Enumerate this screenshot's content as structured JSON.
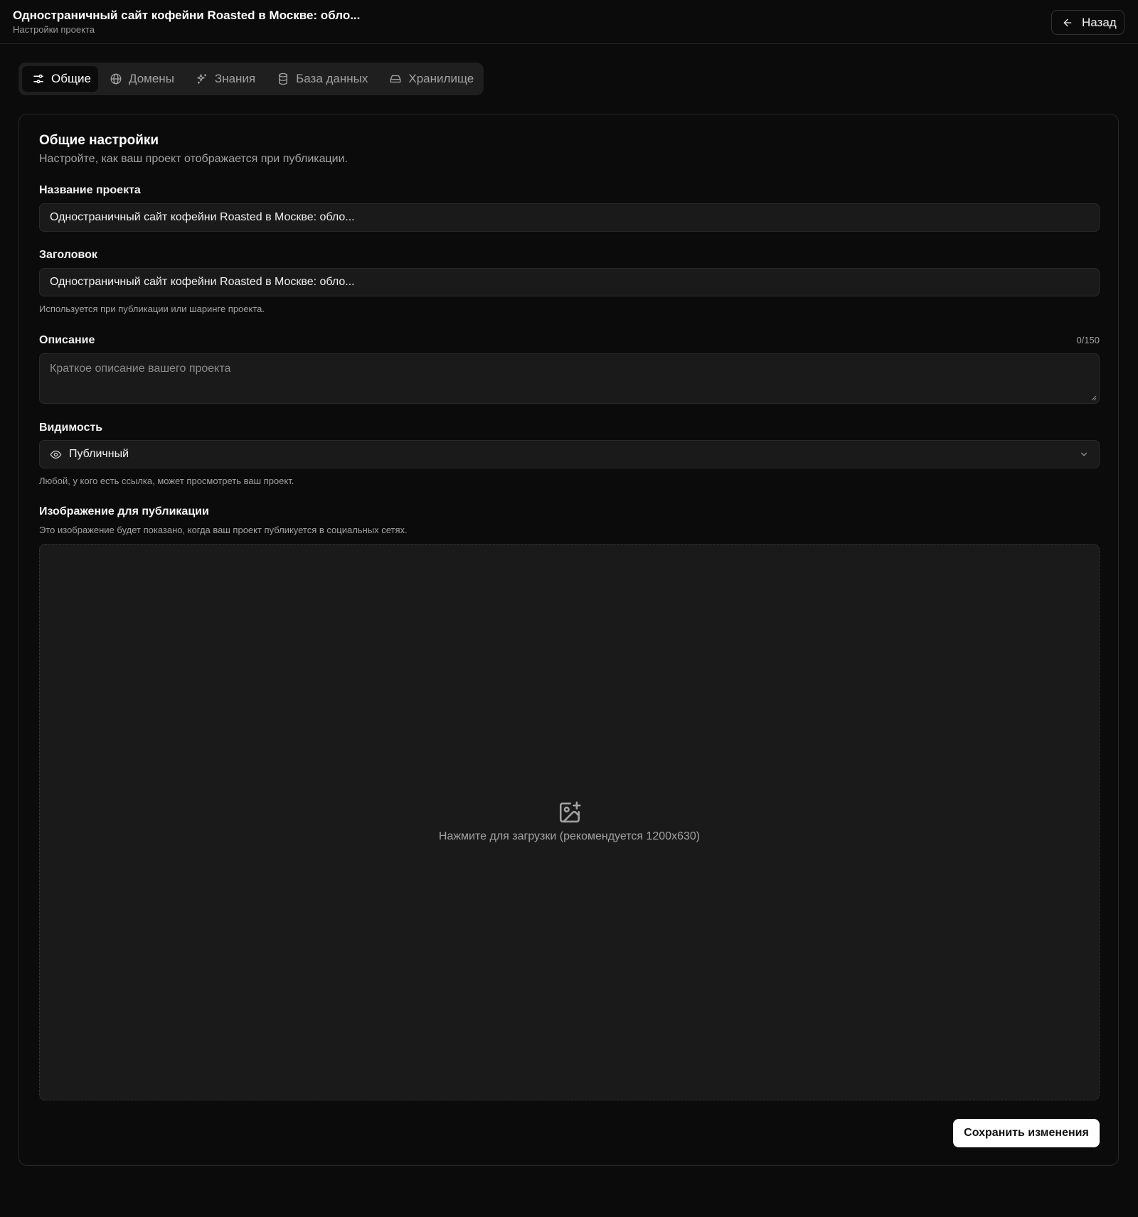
{
  "header": {
    "project_title": "Одностраничный сайт кофейни Roasted в Москве: обло...",
    "subtitle": "Настройки проекта",
    "back_label": "Назад"
  },
  "tabs": [
    {
      "label": "Общие",
      "icon": "sliders-icon",
      "active": true
    },
    {
      "label": "Домены",
      "icon": "globe-icon",
      "active": false
    },
    {
      "label": "Знания",
      "icon": "sparkles-icon",
      "active": false
    },
    {
      "label": "База данных",
      "icon": "database-icon",
      "active": false
    },
    {
      "label": "Хранилище",
      "icon": "hard-drive-icon",
      "active": false
    }
  ],
  "general": {
    "title": "Общие настройки",
    "subtitle": "Настройте, как ваш проект отображается при публикации.",
    "project_name": {
      "label": "Название проекта",
      "value": "Одностраничный сайт кофейни Roasted в Москве: обло..."
    },
    "heading": {
      "label": "Заголовок",
      "value": "Одностраничный сайт кофейни Roasted в Москве: обло...",
      "hint": "Используется при публикации или шаринге проекта."
    },
    "description": {
      "label": "Описание",
      "counter": "0/150",
      "placeholder": "Краткое описание вашего проекта",
      "value": ""
    },
    "visibility": {
      "label": "Видимость",
      "value": "Публичный",
      "icon": "eye-icon",
      "hint": "Любой, у кого есть ссылка, может просмотреть ваш проект."
    },
    "og_image": {
      "label": "Изображение для публикации",
      "hint": "Это изображение будет показано, когда ваш проект публикуется в социальных сетях.",
      "upload_text": "Нажмите для загрузки (рекомендуется 1200x630)",
      "icon": "image-plus-icon"
    },
    "save_label": "Сохранить изменения"
  },
  "colors": {
    "background": "#0b0b0b",
    "surface": "#1a1a1a",
    "tabs_bg": "#1f1f1f",
    "border": "#262626",
    "text_muted": "#a3a3a3",
    "primary_button": "#ffffff"
  }
}
